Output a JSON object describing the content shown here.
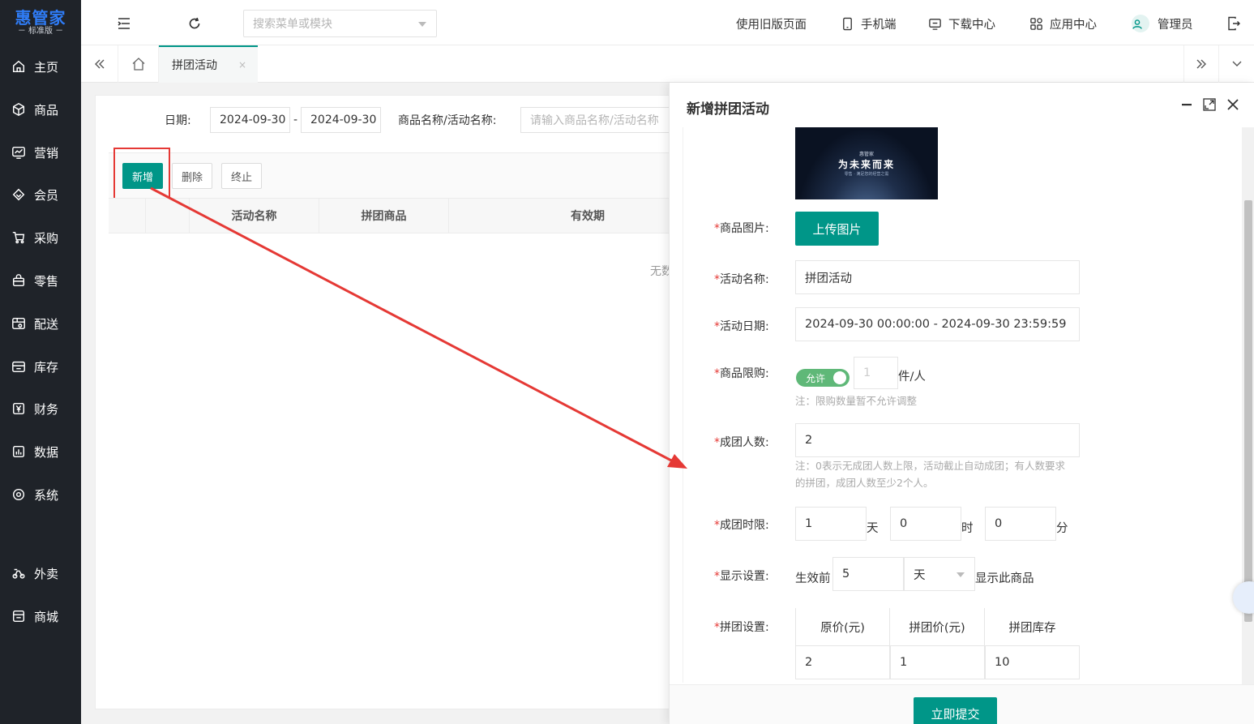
{
  "sidebar": {
    "logo": {
      "brand": "惠管家",
      "edition": "－ 标准版 －"
    },
    "items": [
      {
        "label": "主页",
        "icon": "home-icon"
      },
      {
        "label": "商品",
        "icon": "box-icon"
      },
      {
        "label": "营销",
        "icon": "chart-board-icon"
      },
      {
        "label": "会员",
        "icon": "diamond-icon"
      },
      {
        "label": "采购",
        "icon": "cart-icon"
      },
      {
        "label": "零售",
        "icon": "bag-icon"
      },
      {
        "label": "配送",
        "icon": "truck-icon"
      },
      {
        "label": "库存",
        "icon": "warehouse-icon"
      },
      {
        "label": "财务",
        "icon": "yuan-icon"
      },
      {
        "label": "数据",
        "icon": "bar-chart-icon"
      },
      {
        "label": "系统",
        "icon": "settings-icon"
      },
      {
        "label": "外卖",
        "icon": "scooter-icon"
      },
      {
        "label": "商城",
        "icon": "shop-icon"
      }
    ]
  },
  "topbar": {
    "search_placeholder": "搜索菜单或模块",
    "links": {
      "old_page": "使用旧版页面",
      "mobile": "手机端",
      "download": "下载中心",
      "apps": "应用中心",
      "user": "管理员"
    }
  },
  "tabs": {
    "active": "拼团活动",
    "close": "×"
  },
  "filter": {
    "date_label": "日期:",
    "date_from": "2024-09-30",
    "date_sep": "-",
    "date_to": "2024-09-30",
    "name_label": "商品名称/活动名称:",
    "name_placeholder": "请输入商品名称/活动名称"
  },
  "toolbar": {
    "add": "新增",
    "delete": "删除",
    "stop": "终止"
  },
  "table": {
    "columns": [
      "活动名称",
      "拼团商品",
      "有效期"
    ],
    "empty": "无数"
  },
  "drawer": {
    "title": "新增拼团活动",
    "banner": {
      "small": "惠管家",
      "headline": "为未来而来",
      "sub": "零售 · 满足您的经营之需"
    },
    "fields": {
      "image": {
        "label": "商品图片:",
        "button": "上传图片"
      },
      "name": {
        "label": "活动名称:",
        "value": "拼团活动"
      },
      "date": {
        "label": "活动日期:",
        "value": "2024-09-30 00:00:00 - 2024-09-30 23:59:59"
      },
      "limit": {
        "label": "商品限购:",
        "toggle": "允许",
        "qty": "1",
        "unit": "件/人",
        "note": "注：限购数量暂不允许调整"
      },
      "group_size": {
        "label": "成团人数:",
        "value": "2",
        "note1": "注：0表示无成团人数上限，活动截止自动成团；有人数要求",
        "note2": "的拼团，成团人数至少2个人。"
      },
      "time_limit": {
        "label": "成团时限:",
        "days": "1",
        "days_unit": "天",
        "hours": "0",
        "hours_unit": "时",
        "minutes": "0",
        "minutes_unit": "分"
      },
      "display": {
        "label": "显示设置:",
        "prefix": "生效前",
        "value": "5",
        "unit": "天",
        "suffix": "显示此商品"
      },
      "group_setting": {
        "label": "拼团设置:",
        "headers": [
          "原价(元)",
          "拼团价(元)",
          "拼团库存"
        ],
        "values": [
          "2",
          "1",
          "10"
        ]
      }
    },
    "required_mark": "*",
    "submit": "立即提交"
  },
  "colors": {
    "accent": "#009688",
    "sidebar_bg": "#1f2329",
    "highlight": "#e53935",
    "logo": "#2f7cf6"
  }
}
